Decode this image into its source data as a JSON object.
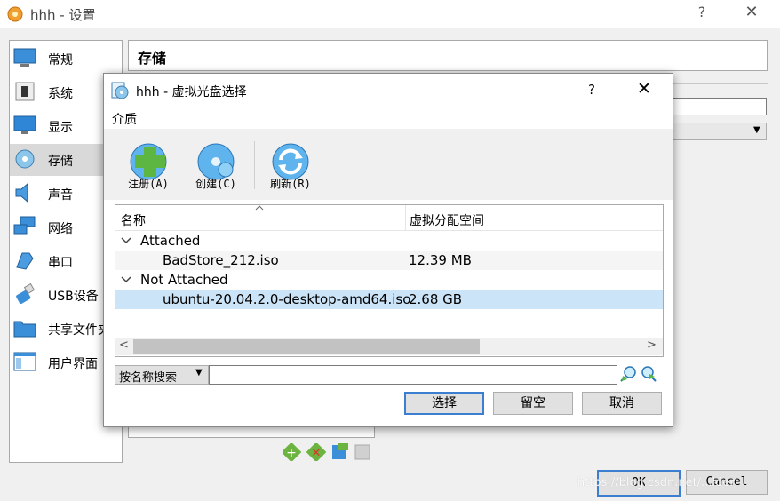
{
  "main_window": {
    "title": "hhh - 设置",
    "help_label": "?",
    "close_label": "✕",
    "sidebar": {
      "items": [
        {
          "label": "常规",
          "icon": "general-icon"
        },
        {
          "label": "系统",
          "icon": "system-icon"
        },
        {
          "label": "显示",
          "icon": "display-icon"
        },
        {
          "label": "存储",
          "icon": "storage-icon",
          "selected": true
        },
        {
          "label": "声音",
          "icon": "audio-icon"
        },
        {
          "label": "网络",
          "icon": "network-icon"
        },
        {
          "label": "串口",
          "icon": "serial-port-icon"
        },
        {
          "label": "USB设备",
          "icon": "usb-icon"
        },
        {
          "label": "共享文件夹",
          "icon": "shared-folder-icon"
        },
        {
          "label": "用户界面",
          "icon": "user-interface-icon"
        }
      ]
    },
    "page_title": "存储",
    "ok_label": "OK",
    "cancel_label": "Cancel",
    "watermark": "https://blog.csdn.net/...lder"
  },
  "dialog": {
    "title": "hhh - 虚拟光盘选择",
    "help_label": "?",
    "close_label": "✕",
    "menu": {
      "media": "介质"
    },
    "toolbar": {
      "register": "注册(A)",
      "create": "创建(C)",
      "refresh": "刷新(R)"
    },
    "tree": {
      "columns": {
        "name": "名称",
        "size": "虚拟分配空间"
      },
      "groups": [
        {
          "label": "Attached",
          "items": [
            {
              "name": "BadStore_212.iso",
              "size": "12.39 MB"
            }
          ]
        },
        {
          "label": "Not Attached",
          "items": [
            {
              "name": "ubuntu-20.04.2.0-desktop-amd64.iso",
              "size": "2.68 GB",
              "selected": true
            }
          ]
        }
      ]
    },
    "search": {
      "mode": "按名称搜索",
      "value": ""
    },
    "buttons": {
      "choose": "选择",
      "leave_empty": "留空",
      "cancel": "取消"
    }
  },
  "colors": {
    "selection": "#cce4f7",
    "accent": "#3c7fd1",
    "sidebar_selected": "#d9d9d9"
  }
}
